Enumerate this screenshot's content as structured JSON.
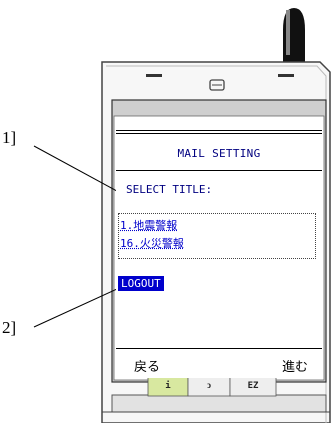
{
  "screen": {
    "title": "MAIL SETTING",
    "prompt": "SELECT TITLE:",
    "options": [
      "1.地震警報",
      "16.火災警報"
    ],
    "logout_label": "LOGOUT",
    "softkey_left": "戻る",
    "softkey_right": "進む"
  },
  "keys": {
    "left": "i",
    "center": "ↄ",
    "right": "EZ"
  },
  "callouts": {
    "label_1": "1]",
    "label_2": "2]"
  },
  "colors": {
    "text_navy": "#000080",
    "link_blue": "#0000cc",
    "highlight_blue": "#0000cc"
  }
}
